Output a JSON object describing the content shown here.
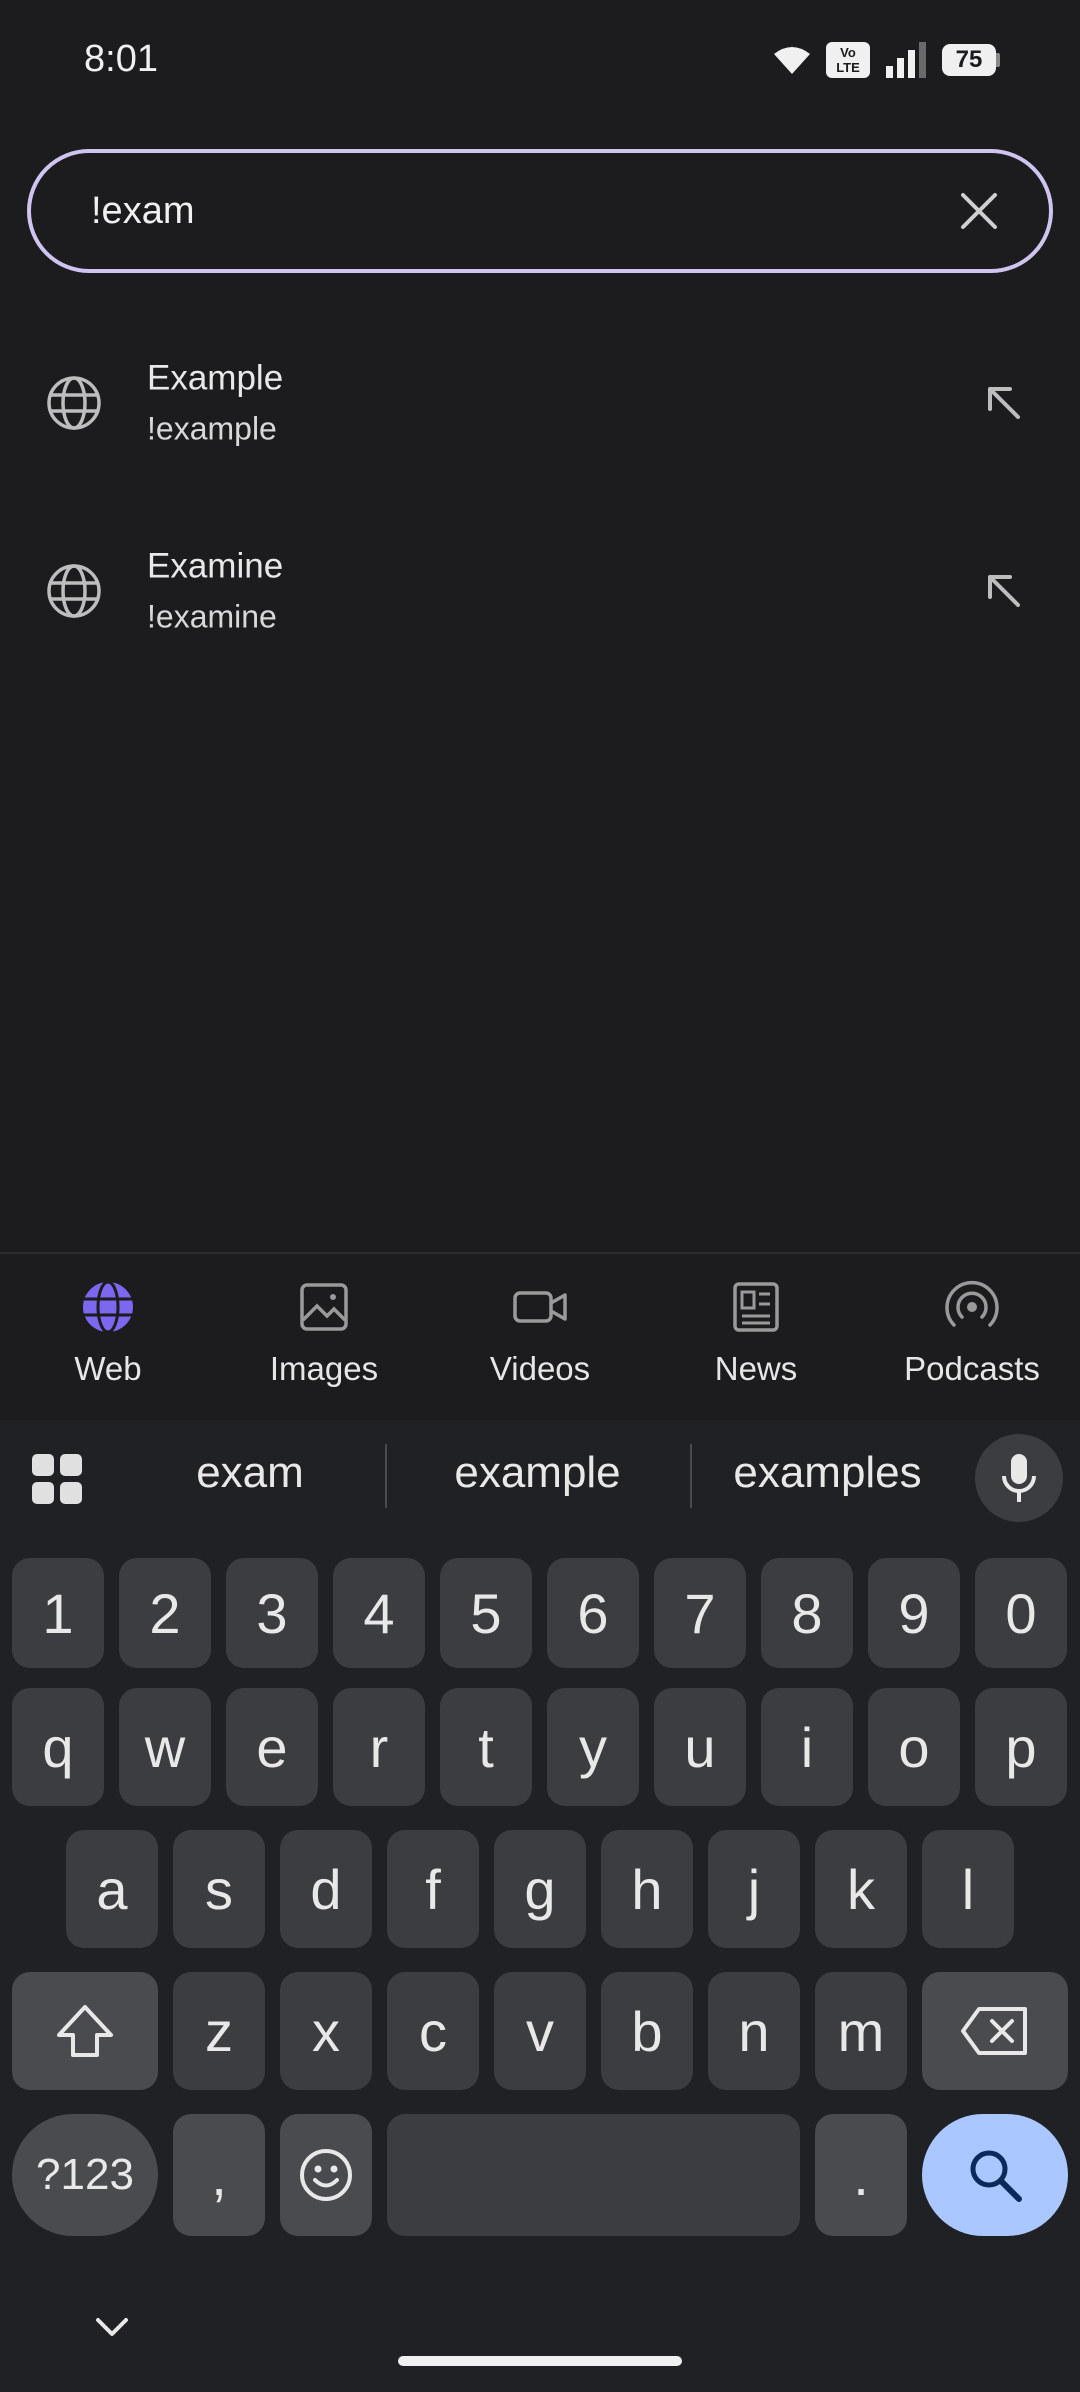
{
  "status": {
    "time": "8:01",
    "volte": "Vo\nLTE",
    "battery": "75"
  },
  "search": {
    "query": "!exam"
  },
  "suggestions": [
    {
      "title": "Example",
      "bang": "!example"
    },
    {
      "title": "Examine",
      "bang": "!examine"
    }
  ],
  "tabs": [
    {
      "label": "Web",
      "icon": "globe-icon",
      "active": true
    },
    {
      "label": "Images",
      "icon": "image-icon"
    },
    {
      "label": "Videos",
      "icon": "video-icon"
    },
    {
      "label": "News",
      "icon": "news-icon"
    },
    {
      "label": "Podcasts",
      "icon": "podcast-icon"
    }
  ],
  "keyboard": {
    "suggestions": [
      "exam",
      "example",
      "examples"
    ],
    "number_row": [
      "1",
      "2",
      "3",
      "4",
      "5",
      "6",
      "7",
      "8",
      "9",
      "0"
    ],
    "row1": [
      "q",
      "w",
      "e",
      "r",
      "t",
      "y",
      "u",
      "i",
      "o",
      "p"
    ],
    "row2": [
      "a",
      "s",
      "d",
      "f",
      "g",
      "h",
      "j",
      "k",
      "l"
    ],
    "row3": [
      "z",
      "x",
      "c",
      "v",
      "b",
      "n",
      "m"
    ],
    "symbols_label": "?123",
    "comma": ",",
    "period": "."
  },
  "colors": {
    "accent": "#cfc4f0",
    "active_tab": "#7b68ee",
    "search_key": "#aac7ff",
    "background": "#1c1c1e"
  }
}
